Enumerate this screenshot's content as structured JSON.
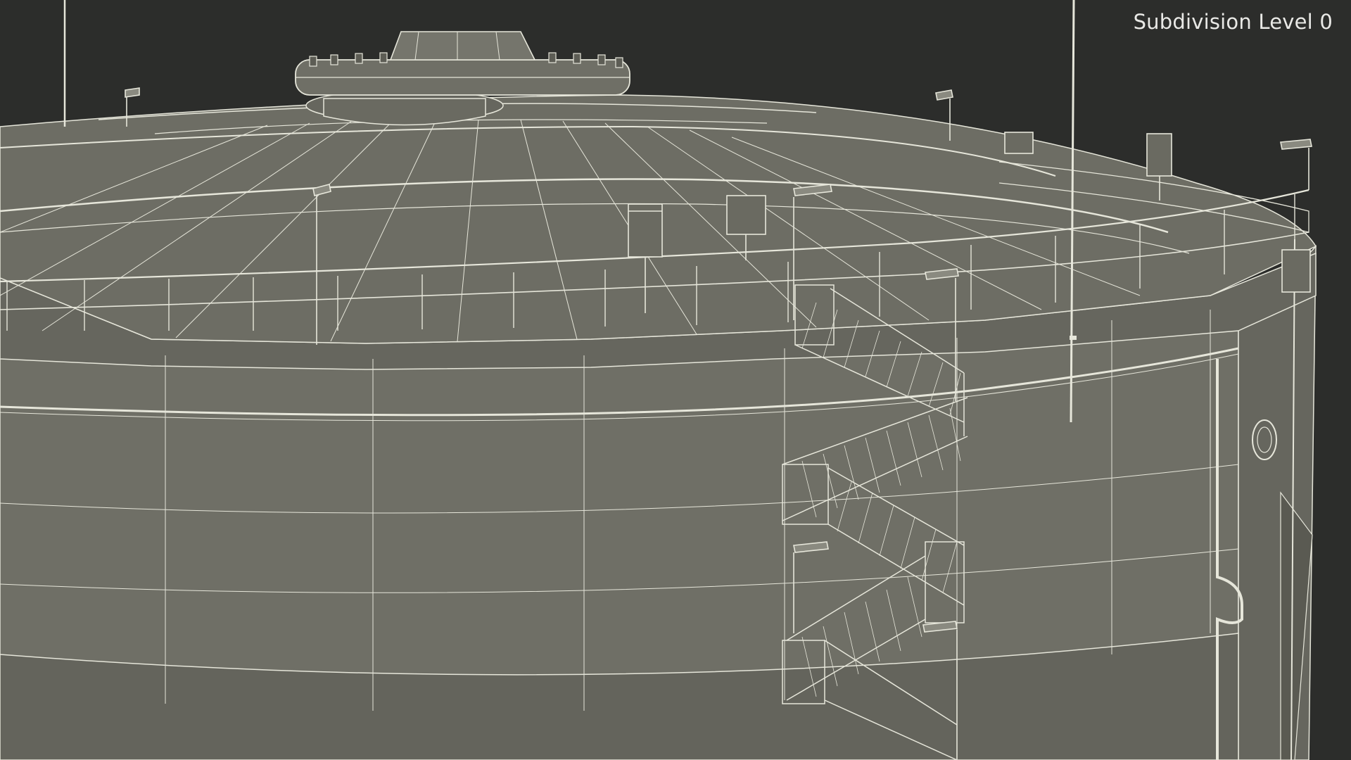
{
  "viewport": {
    "overlay_label": "Subdivision Level 0"
  },
  "colors": {
    "background": "#2c2d2b",
    "surface": "#6f6f66",
    "surface_dark": "#5f5f57",
    "wire": "#e6e6da",
    "label": "#e9e9e6"
  }
}
